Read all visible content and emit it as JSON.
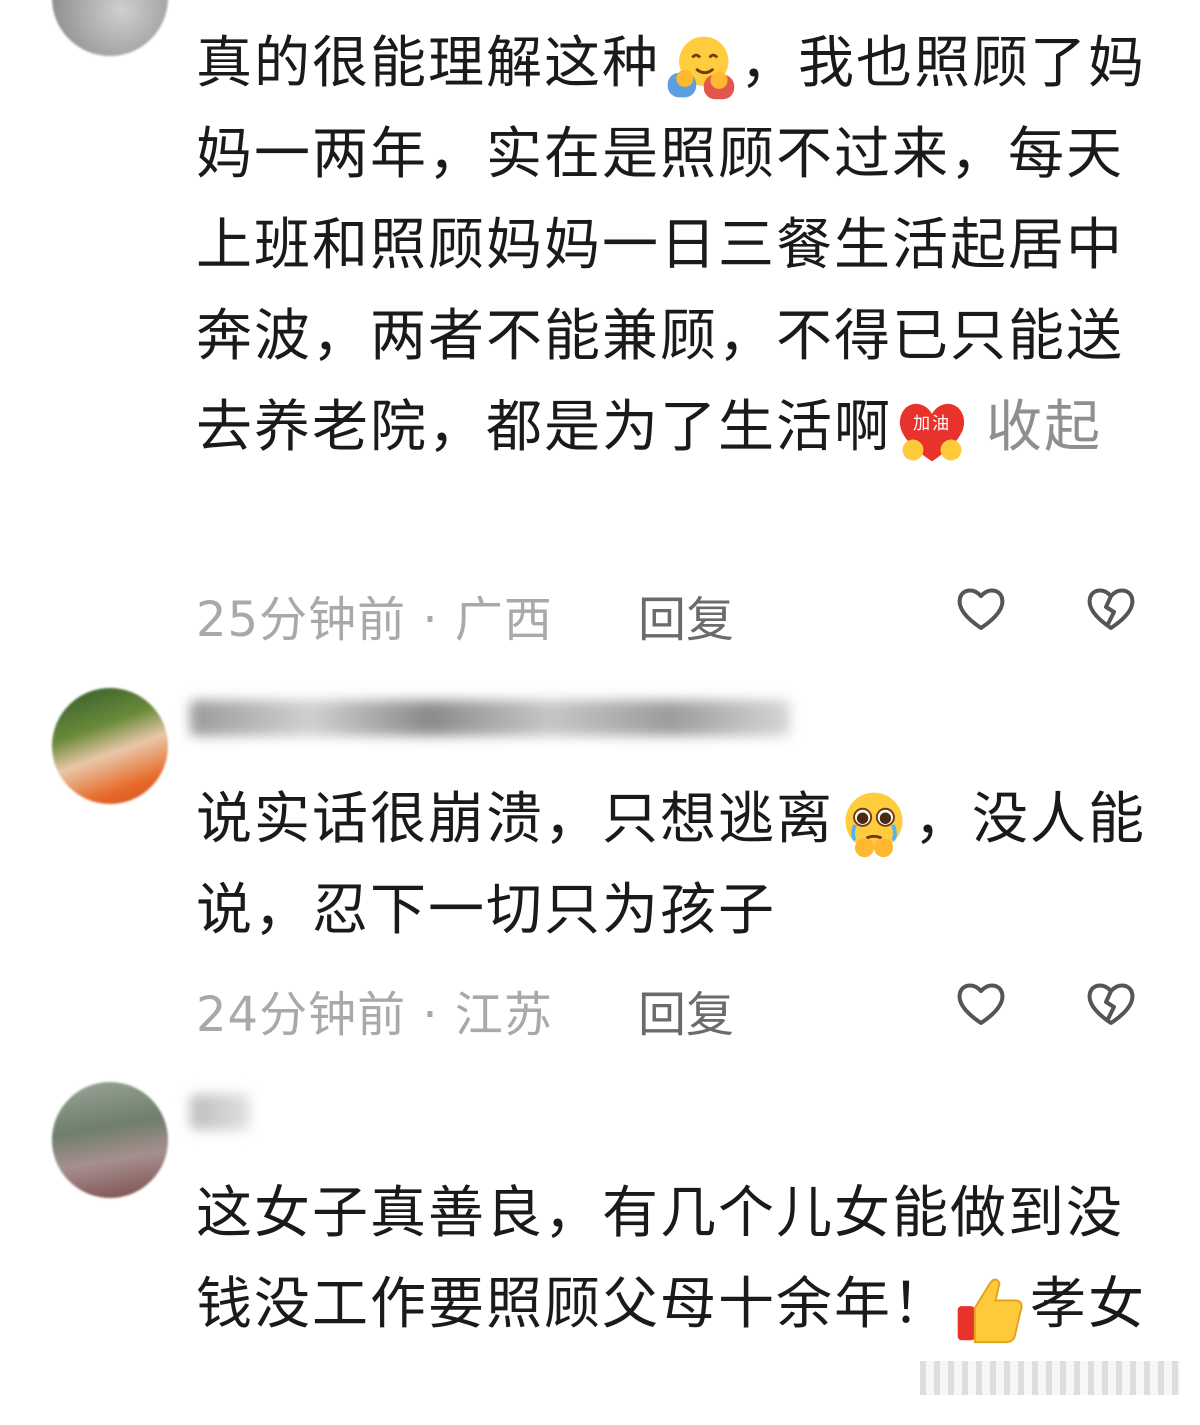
{
  "comments": [
    {
      "text_parts": [
        "真的很能理解这种",
        "，我也照顾了妈妈一两年，实在是照顾不过来，每天上班和照顾妈妈一日三餐生活起居中奔波，两者不能兼顾，不得已只能送去养老院，都是为了生活啊"
      ],
      "emoji_1": "hugging-face-emoji",
      "emoji_2": "jiayou-heart-emoji",
      "emoji_2_text": "加油",
      "collapse_label": "收起",
      "time": "25分钟前",
      "location": "广西",
      "reply_label": "回复",
      "like_icon": "heart-outline-icon",
      "dislike_icon": "broken-heart-icon"
    },
    {
      "text_parts": [
        "说实话很崩溃，只想逃离",
        "，没人能说，忍下一切只为孩子"
      ],
      "emoji_1": "pleading-crying-face-emoji",
      "time": "24分钟前",
      "location": "江苏",
      "reply_label": "回复",
      "like_icon": "heart-outline-icon",
      "dislike_icon": "broken-heart-icon"
    },
    {
      "text_parts": [
        "这女子真善良，有几个儿女能做到没钱没工作要照顾父母十余年！",
        "孝女"
      ],
      "emoji_1": "thumbs-up-emoji"
    }
  ],
  "separator": "·",
  "colors": {
    "text": "#1a1a1a",
    "meta": "#a9a9a9",
    "reply": "#6b6b6b",
    "icon": "#555555"
  }
}
